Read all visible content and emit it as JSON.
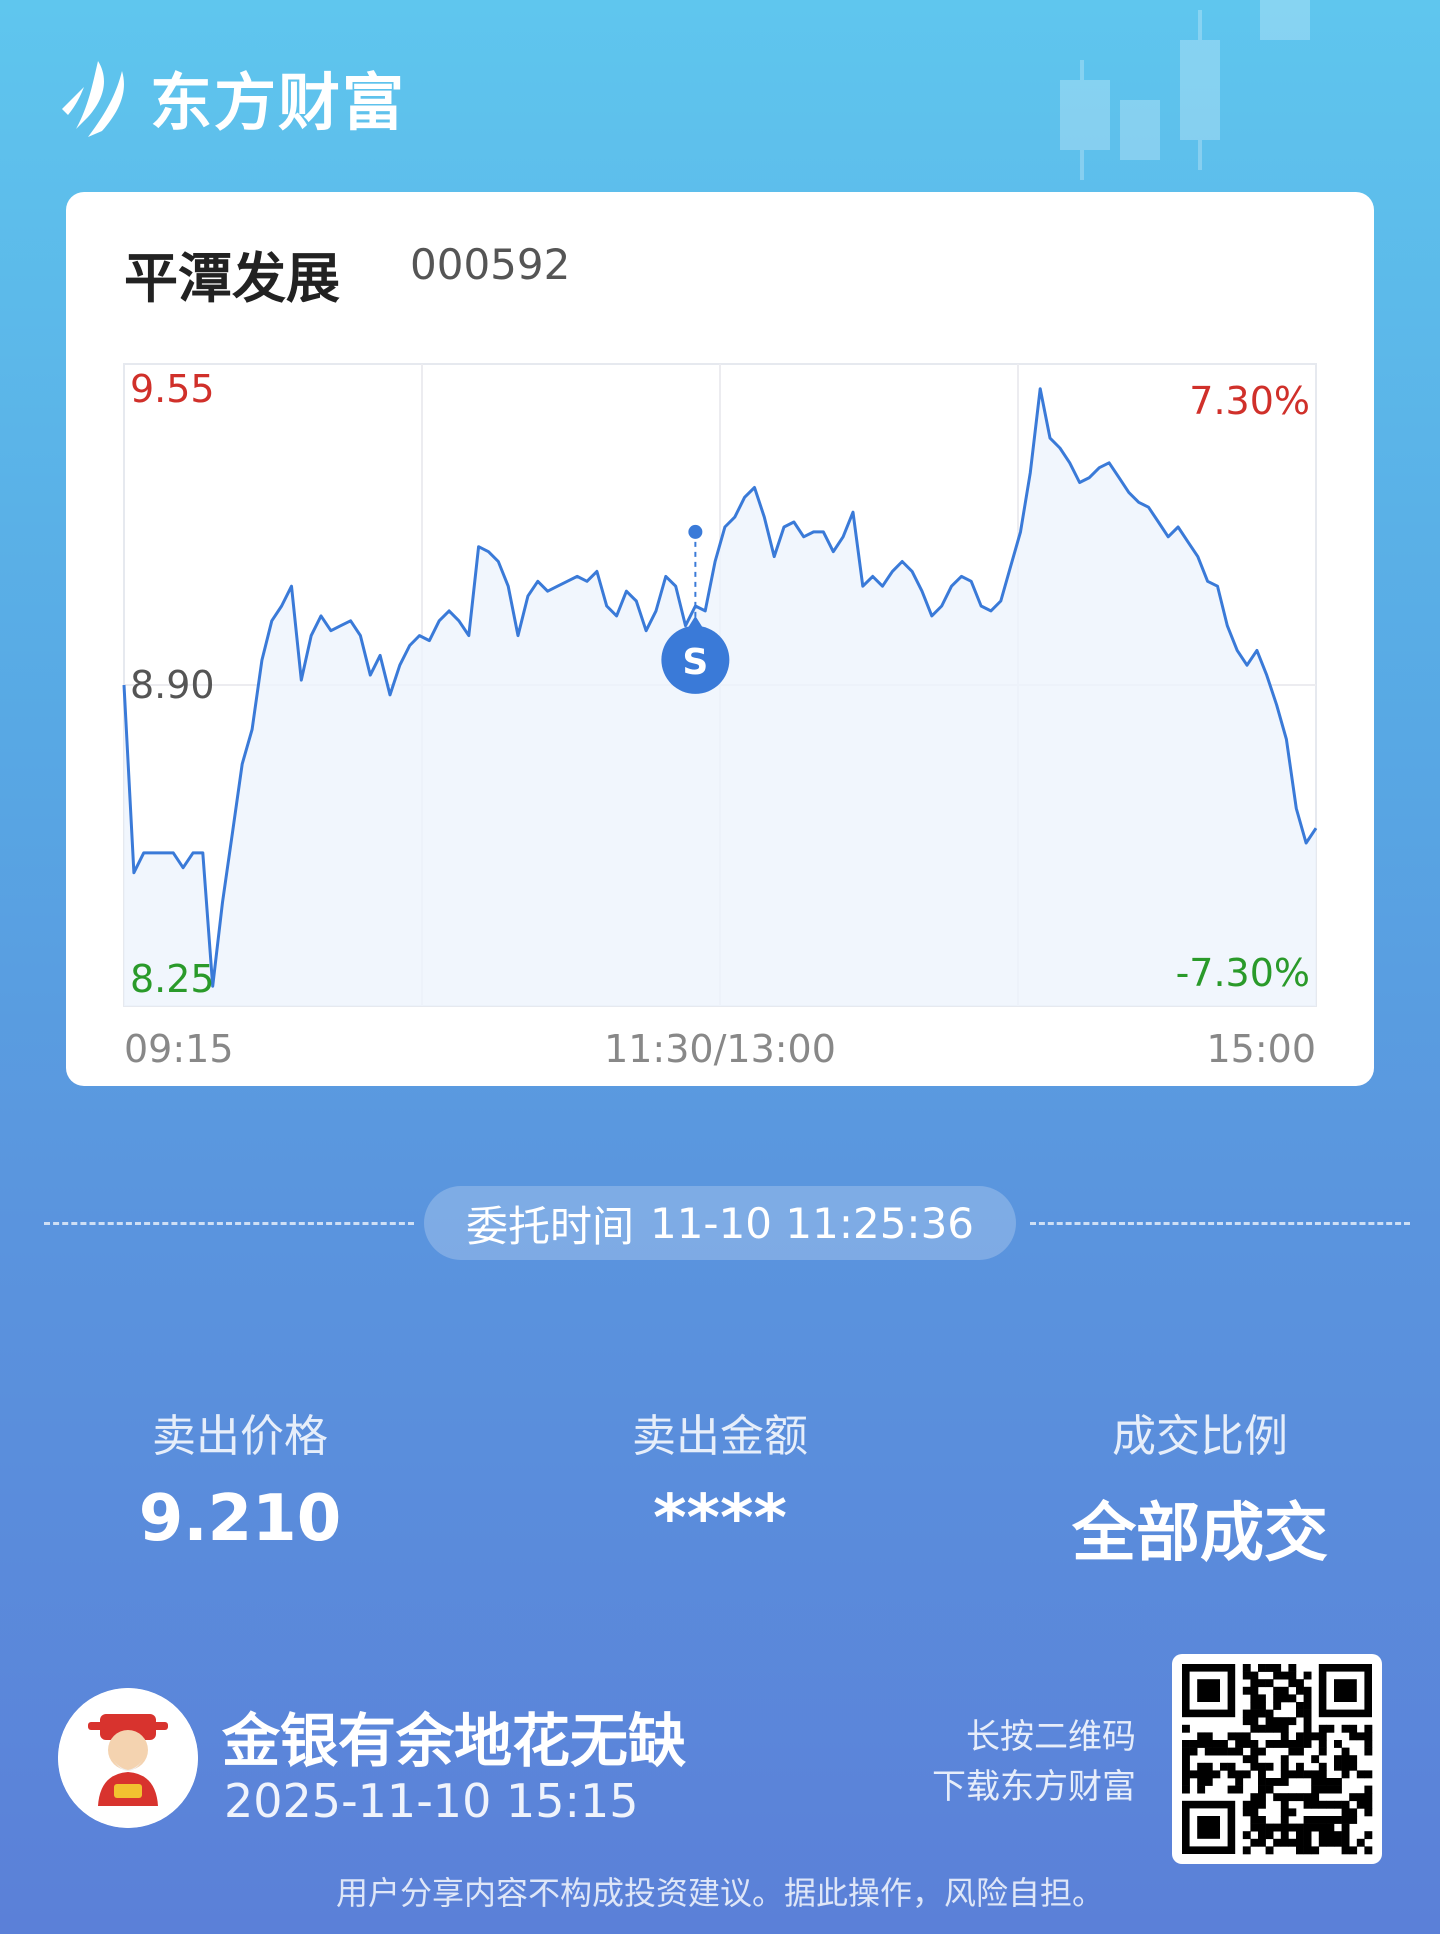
{
  "brand": {
    "name": "东方财富"
  },
  "stock": {
    "name": "平潭发展",
    "code": "000592"
  },
  "chart_data": {
    "type": "line",
    "x_ticks": [
      "09:15",
      "11:30/13:00",
      "15:00"
    ],
    "y_ticks_left": {
      "top": "9.55",
      "mid": "8.90",
      "bottom": "8.25"
    },
    "y_ticks_right": {
      "top": "7.30%",
      "bottom": "-7.30%"
    },
    "ylim": [
      8.25,
      9.55
    ],
    "series": [
      {
        "values": [
          8.9,
          8.52,
          8.56,
          8.56,
          8.56,
          8.56,
          8.53,
          8.56,
          8.56,
          8.29,
          8.46,
          8.6,
          8.74,
          8.81,
          8.95,
          9.03,
          9.06,
          9.1,
          8.91,
          9.0,
          9.04,
          9.01,
          9.02,
          9.03,
          9.0,
          8.92,
          8.96,
          8.88,
          8.94,
          8.98,
          9.0,
          8.99,
          9.03,
          9.05,
          9.03,
          9.0,
          9.18,
          9.17,
          9.15,
          9.1,
          9.0,
          9.08,
          9.11,
          9.09,
          9.1,
          9.11,
          9.12,
          9.11,
          9.13,
          9.06,
          9.04,
          9.09,
          9.07,
          9.01,
          9.05,
          9.12,
          9.1,
          9.02,
          9.06,
          9.05,
          9.15,
          9.22,
          9.24,
          9.28,
          9.3,
          9.24,
          9.16,
          9.22,
          9.23,
          9.2,
          9.21,
          9.21,
          9.17,
          9.2,
          9.25,
          9.1,
          9.12,
          9.1,
          9.13,
          9.15,
          9.13,
          9.09,
          9.04,
          9.06,
          9.1,
          9.12,
          9.11,
          9.06,
          9.05,
          9.07,
          9.14,
          9.21,
          9.33,
          9.5,
          9.4,
          9.38,
          9.35,
          9.31,
          9.32,
          9.34,
          9.35,
          9.32,
          9.29,
          9.27,
          9.26,
          9.23,
          9.2,
          9.22,
          9.19,
          9.16,
          9.11,
          9.1,
          9.02,
          8.97,
          8.94,
          8.97,
          8.92,
          8.86,
          8.79,
          8.65,
          8.58,
          8.61
        ]
      }
    ],
    "marker": {
      "label": "S",
      "price": 9.21,
      "time": "11:25"
    }
  },
  "order": {
    "time_label": "委托时间",
    "time_value": "11-10 11:25:36"
  },
  "stats": [
    {
      "label": "卖出价格",
      "value": "9.210"
    },
    {
      "label": "卖出金额",
      "value": "****"
    },
    {
      "label": "成交比例",
      "value": "全部成交"
    }
  ],
  "footer": {
    "slogan": "金银有余地花无缺",
    "date": "2025-11-10 15:15",
    "qr_line1": "长按二维码",
    "qr_line2": "下载东方财富",
    "disclaimer": "用户分享内容不构成投资建议。据此操作，风险自担。"
  }
}
